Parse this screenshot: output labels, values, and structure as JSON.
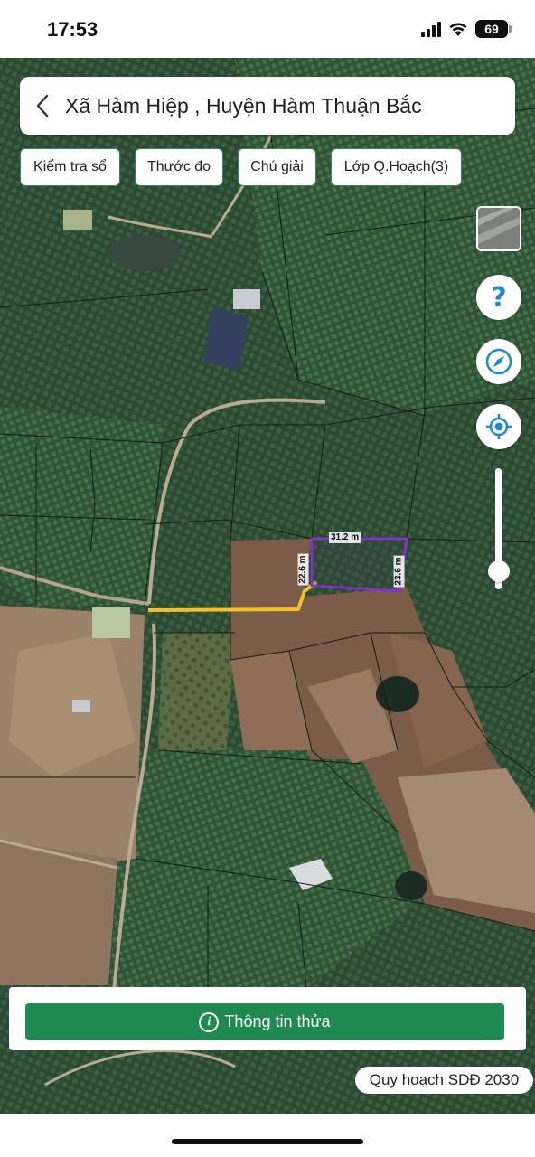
{
  "status_bar": {
    "time": "17:53",
    "battery": "69"
  },
  "header": {
    "title": "Xã Hàm Hiệp , Huyện Hàm Thuận Bắc"
  },
  "toolbar": {
    "check_book": "Kiểm tra sổ",
    "ruler": "Thước đo",
    "legend": "Chú giải",
    "planning_layer": "Lớp Q.Hoạch(3)"
  },
  "controls": {
    "help_glyph": "?",
    "zoom_level": 0.15
  },
  "parcel": {
    "width_label": "31.2 m",
    "left_label": "22.6 m",
    "right_label": "23.6 m",
    "outline_color": "#8a2be2",
    "route_color": "#f5c026"
  },
  "bottom": {
    "info_button": "Thông tin thửa",
    "info_glyph": "i",
    "plan_badge": "Quy hoạch SDĐ 2030"
  },
  "colors": {
    "accent": "#1e8a4f",
    "chip_border": "#2e8b57",
    "icon_blue": "#1e88d6"
  }
}
